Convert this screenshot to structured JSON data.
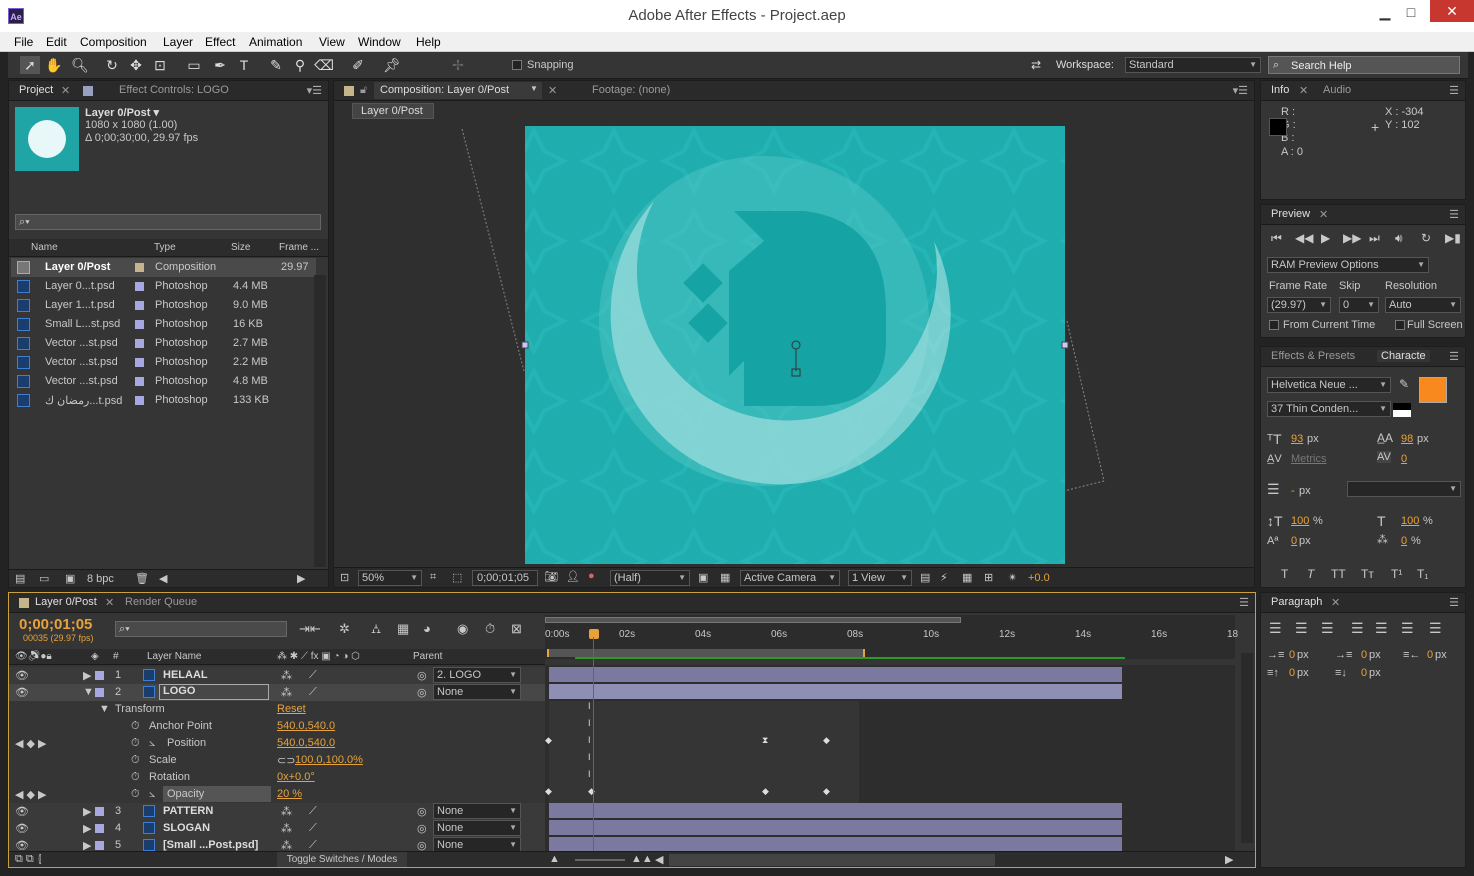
{
  "window": {
    "title": "Adobe After Effects - Project.aep",
    "app_icon": "Ae",
    "min": "▁",
    "max": "□",
    "close": "✕"
  },
  "menu": [
    "File",
    "Edit",
    "Composition",
    "Layer",
    "Effect",
    "Animation",
    "View",
    "Window",
    "Help"
  ],
  "toolbar": {
    "snapping": "Snapping",
    "workspace_label": "Workspace:",
    "workspace": "Standard",
    "search": "Search Help"
  },
  "project": {
    "tab": "Project",
    "tab2": "Effect Controls: LOGO",
    "comp_name": "Layer 0/Post ▾",
    "comp_size": "1080 x 1080 (1.00)",
    "comp_dur": "Δ 0;00;30;00, 29.97 fps",
    "search_placeholder": "⌕▾",
    "cols": {
      "name": "Name",
      "type": "Type",
      "size": "Size",
      "frame": "Frame ..."
    },
    "items": [
      {
        "name": "Layer 0/Post",
        "type": "Composition",
        "size": "",
        "frame": "29.97"
      },
      {
        "name": "Layer 0...t.psd",
        "type": "Photoshop",
        "size": "4.4 MB",
        "frame": ""
      },
      {
        "name": "Layer 1...t.psd",
        "type": "Photoshop",
        "size": "9.0 MB",
        "frame": ""
      },
      {
        "name": "Small L...st.psd",
        "type": "Photoshop",
        "size": "16 KB",
        "frame": ""
      },
      {
        "name": "Vector ...st.psd",
        "type": "Photoshop",
        "size": "2.7 MB",
        "frame": ""
      },
      {
        "name": "Vector ...st.psd",
        "type": "Photoshop",
        "size": "2.2 MB",
        "frame": ""
      },
      {
        "name": "Vector ...st.psd",
        "type": "Photoshop",
        "size": "4.8 MB",
        "frame": ""
      },
      {
        "name": "رمضان ك...t.psd",
        "type": "Photoshop",
        "size": "133 KB",
        "frame": ""
      }
    ],
    "bpc": "8 bpc"
  },
  "comp": {
    "tab": "Composition: Layer 0/Post",
    "footage": "Footage: (none)",
    "crumb": "Layer 0/Post",
    "zoom": "50%",
    "time": "0;00;01;05",
    "res": "(Half)",
    "camera": "Active Camera",
    "view": "1 View",
    "exposure": "+0.0"
  },
  "info": {
    "tab": "Info",
    "tab2": "Audio",
    "r": "R :",
    "g": "G :",
    "b": "B :",
    "a": "A : 0",
    "x": "X : -304",
    "y": "Y : 102"
  },
  "preview": {
    "tab": "Preview",
    "ram": "RAM Preview Options",
    "fr_label": "Frame Rate",
    "skip_label": "Skip",
    "res_label": "Resolution",
    "fr": "(29.97)",
    "skip": "0",
    "res": "Auto",
    "from_current": "From Current Time",
    "full": "Full Screen"
  },
  "character": {
    "tab": "Effects & Presets",
    "tab2": "Characte",
    "font": "Helvetica Neue ...",
    "style": "37 Thin Conden...",
    "size": "93",
    "size_unit": "px",
    "leading": "98",
    "leading_unit": "px",
    "kerning": "Metrics",
    "tracking": "0",
    "stroke": "-",
    "stroke_unit": "px",
    "vscale": "100",
    "vscale_unit": "%",
    "hscale": "100",
    "hscale_unit": "%",
    "baseline": "0",
    "baseline_unit": "px",
    "tsume": "0",
    "tsume_unit": "%",
    "fill_color": "#f7891f",
    "styles": [
      "T",
      "T",
      "TT",
      "Tт",
      "T¹",
      "T₁"
    ]
  },
  "paragraph": {
    "tab": "Paragraph",
    "v1": "0",
    "v2": "0",
    "v3": "0",
    "v4": "0",
    "v5": "0",
    "unit": "px"
  },
  "timeline": {
    "tab": "Layer 0/Post",
    "tab2": "Render Queue",
    "time": "0;00;01;05",
    "frames": "00035 (29.97 fps)",
    "search_placeholder": "⌕▾",
    "cols": {
      "num": "#",
      "name": "Layer Name",
      "parent": "Parent"
    },
    "ruler": [
      "0:00s",
      "02s",
      "04s",
      "06s",
      "08s",
      "10s",
      "12s",
      "14s",
      "16s",
      "18"
    ],
    "layers": [
      {
        "num": "1",
        "name": "HELAAL",
        "parent": "2. LOGO"
      },
      {
        "num": "2",
        "name": "LOGO",
        "parent": "None"
      }
    ],
    "transform": {
      "label": "Transform",
      "reset": "Reset",
      "props": [
        {
          "name": "Anchor Point",
          "value": "540.0,540.0"
        },
        {
          "name": "Position",
          "value": "540.0,540.0"
        },
        {
          "name": "Scale",
          "value": "100.0,100.0%"
        },
        {
          "name": "Rotation",
          "value": "0x+0.0°"
        },
        {
          "name": "Opacity",
          "value": "20 %"
        }
      ]
    },
    "layers2": [
      {
        "num": "3",
        "name": "PATTERN",
        "parent": "None"
      },
      {
        "num": "4",
        "name": "SLOGAN",
        "parent": "None"
      },
      {
        "num": "5",
        "name": "[Small ...Post.psd]",
        "parent": "None"
      }
    ],
    "toggle": "Toggle Switches / Modes"
  }
}
